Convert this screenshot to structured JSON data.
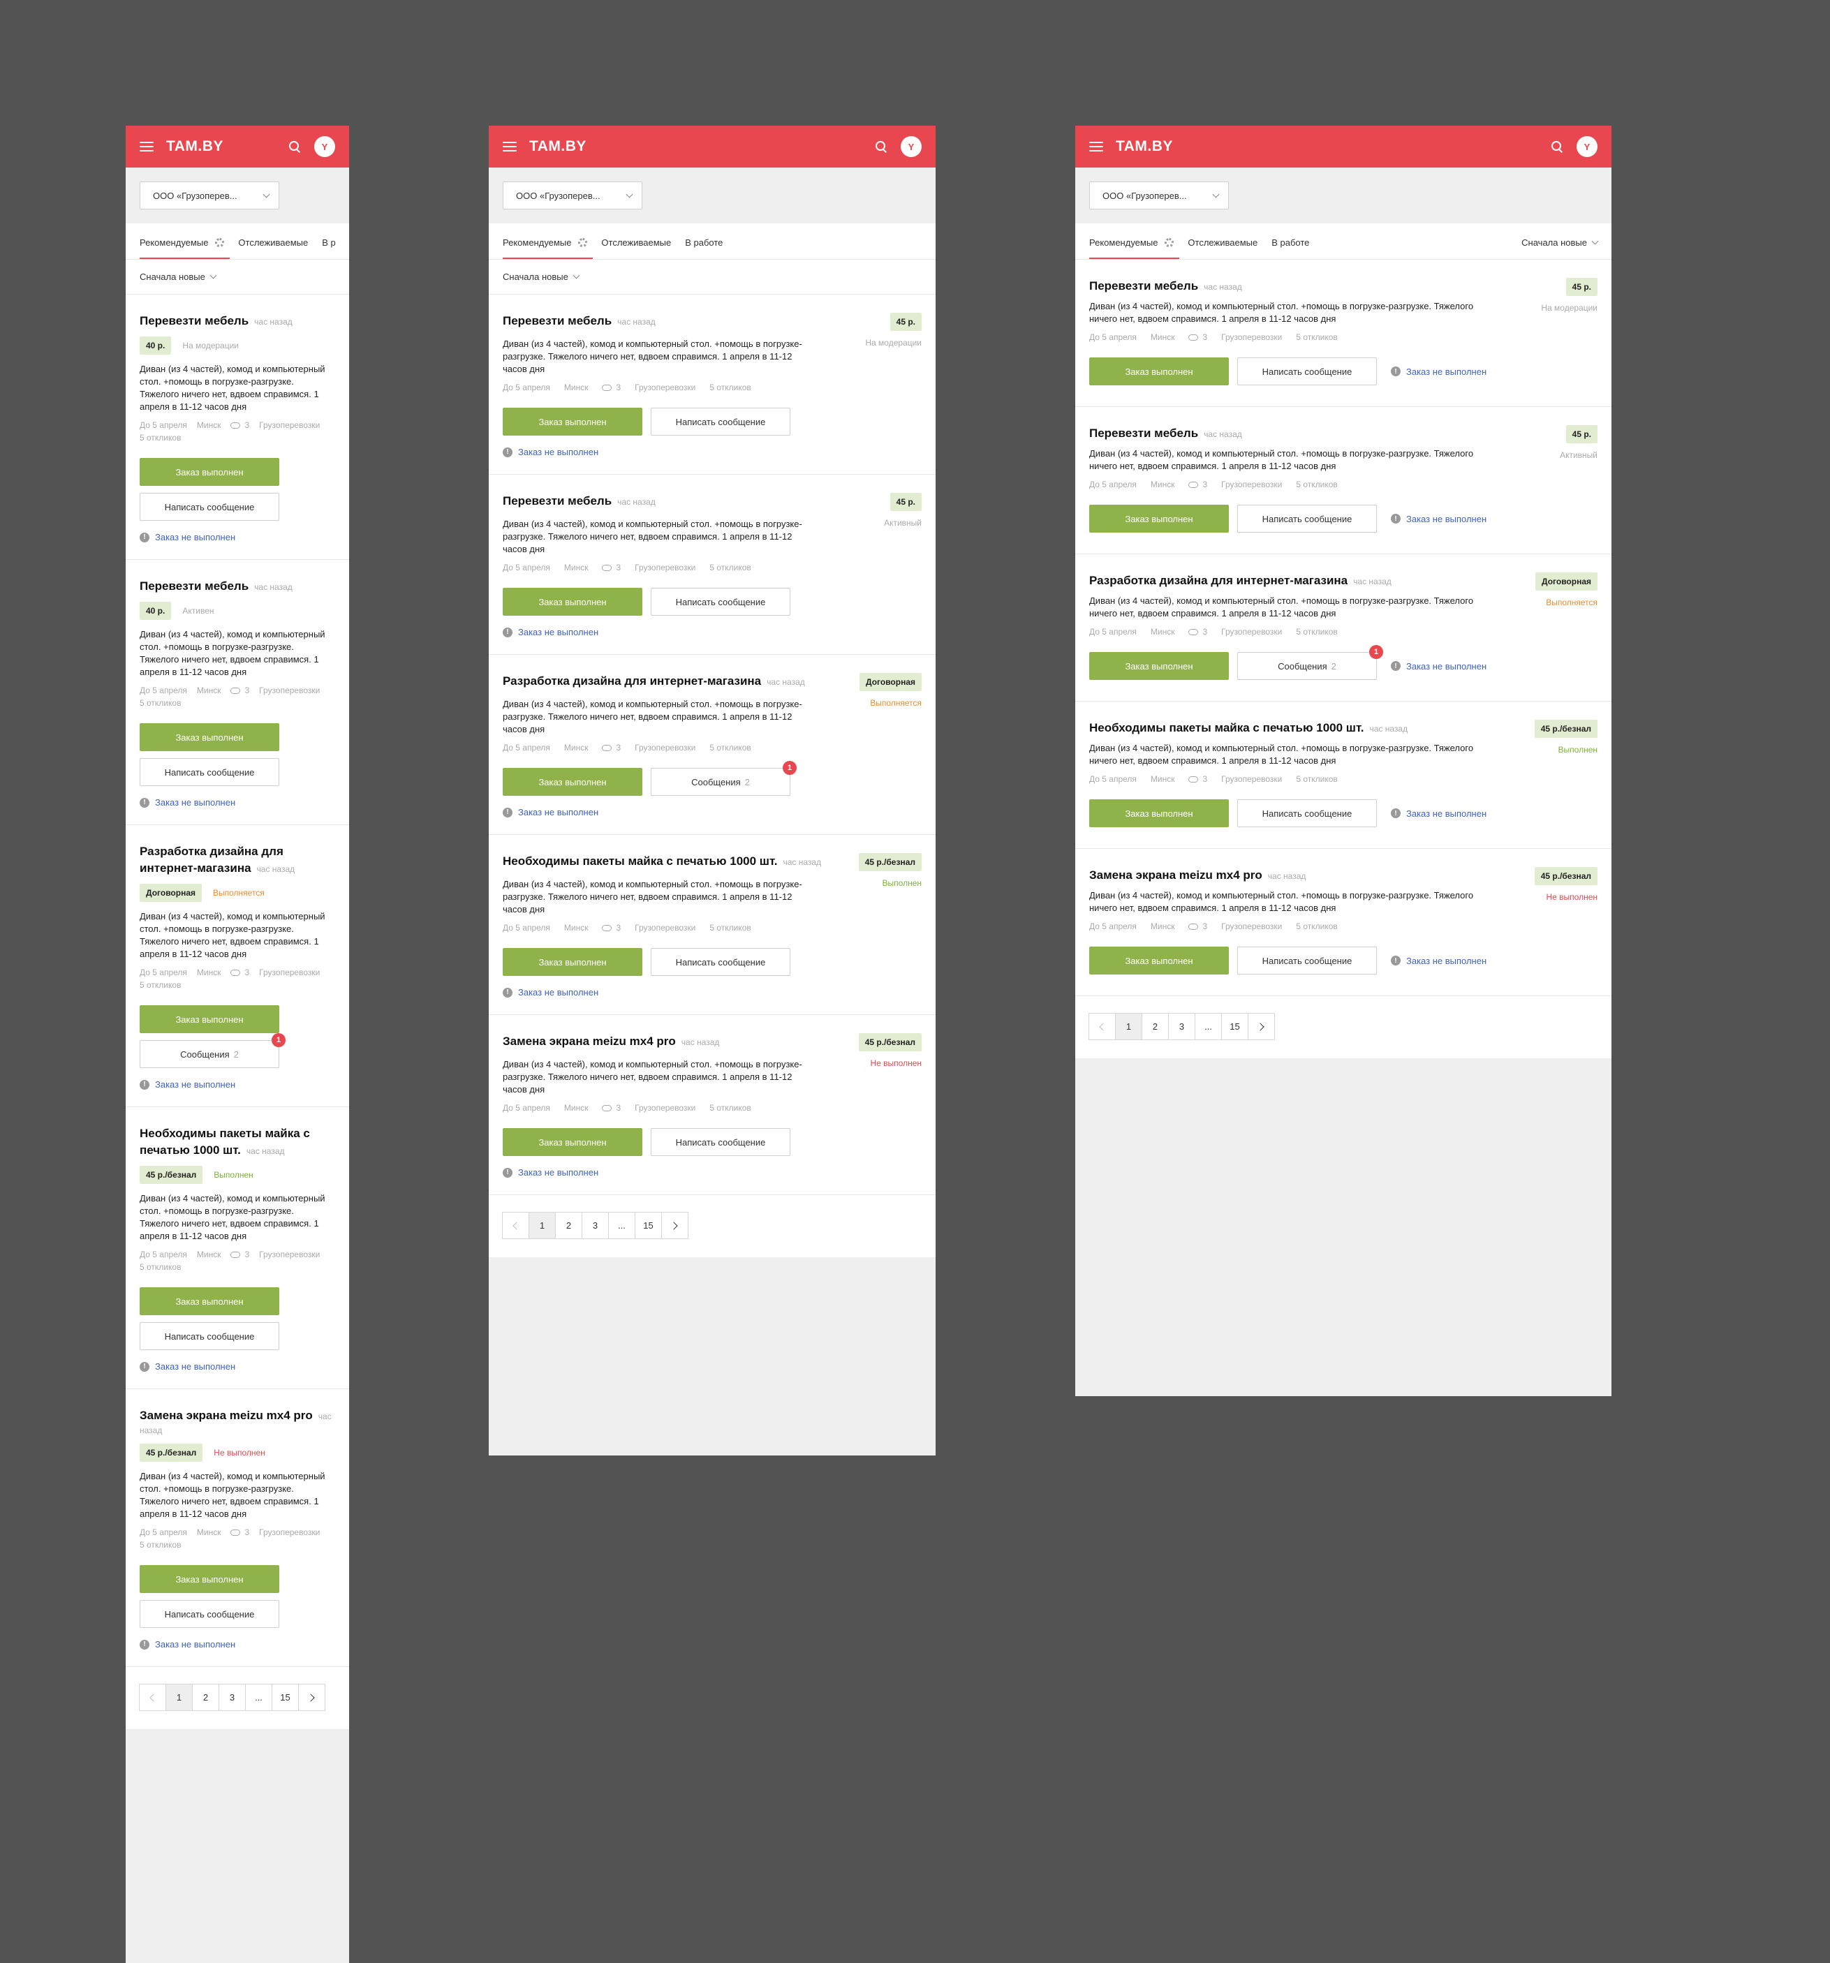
{
  "app": {
    "logo": "TAM.BY",
    "avatar_letter": "Y",
    "company": "ООО «Грузоперев...",
    "tabs": [
      "Рекомендуемые",
      "Отслеживаемые",
      "В работе"
    ],
    "tab_narrow_cut": "В р",
    "sort": "Сначала новые",
    "colors": {
      "brand": "#e9474f",
      "accent": "#8fb24a",
      "price_bg": "#e1ecd0",
      "link": "#3f62c6",
      "background": "#535353"
    },
    "icons": [
      "hamburger-menu-icon",
      "search-icon",
      "gear-icon",
      "chevron-down-icon",
      "comment-icon",
      "info-icon",
      "chevron-left-icon",
      "chevron-right-icon"
    ]
  },
  "cards": [
    {
      "title": "Перевезти мебель",
      "time": "час назад",
      "price": "40 р.",
      "price_wide": "45 р.",
      "status": "На модерации",
      "status_type": "moderation",
      "desc": "Диван (из 4 частей), комод и компьютерный стол. +помощь в погрузке-разгрузке. Тяжелого ничего нет, вдвоем справимся. 1 апреля в 11-12 часов дня",
      "date": "До 5 апреля",
      "city": "Минск",
      "comments": "3",
      "category": "Грузоперевозки",
      "responses": "5 откликов",
      "primary": "Заказ выполнен",
      "secondary": "Написать сообщение",
      "secondary_count": "",
      "badge": "",
      "fail_link": "Заказ не выполнен"
    },
    {
      "title": "Перевезти мебель",
      "time": "час назад",
      "price": "40 р.",
      "price_wide": "45 р.",
      "status": "Активный",
      "status_type": "active",
      "status_narrow": "Активен",
      "desc": "Диван (из 4 частей), комод и компьютерный стол. +помощь в погрузке-разгрузке. Тяжелого ничего нет, вдвоем справимся. 1 апреля в 11-12 часов дня",
      "date": "До 5 апреля",
      "city": "Минск",
      "comments": "3",
      "category": "Грузоперевозки",
      "responses": "5 откликов",
      "primary": "Заказ выполнен",
      "secondary": "Написать сообщение",
      "secondary_count": "",
      "badge": "",
      "fail_link": "Заказ не выполнен"
    },
    {
      "title": "Разработка дизайна для интернет-магазина",
      "time": "час назад",
      "price": "Договорная",
      "price_wide": "Договорная",
      "status": "Выполняется",
      "status_type": "progress",
      "desc": "Диван (из 4 частей), комод и компьютерный стол. +помощь в погрузке-разгрузке. Тяжелого ничего нет, вдвоем справимся. 1 апреля в 11-12 часов дня",
      "date": "До 5 апреля",
      "city": "Минск",
      "comments": "3",
      "category": "Грузоперевозки",
      "responses": "5 откликов",
      "primary": "Заказ выполнен",
      "secondary": "Сообщения",
      "secondary_count": "2",
      "badge": "1",
      "fail_link": "Заказ не выполнен"
    },
    {
      "title": "Необходимы пакеты майка с печатью 1000 шт.",
      "time": "час назад",
      "price": "45 р./безнал",
      "price_wide": "45 р./безнал",
      "status": "Выполнен",
      "status_type": "done",
      "desc": "Диван (из 4 частей), комод и компьютерный стол. +помощь в погрузке-разгрузке. Тяжелого ничего нет, вдвоем справимся. 1 апреля в 11-12 часов дня",
      "date": "До 5 апреля",
      "city": "Минск",
      "comments": "3",
      "category": "Грузоперевозки",
      "responses": "5 откликов",
      "primary": "Заказ выполнен",
      "secondary": "Написать сообщение",
      "secondary_count": "",
      "badge": "",
      "fail_link": "Заказ не выполнен"
    },
    {
      "title": "Замена экрана meizu mx4 pro",
      "time": "час назад",
      "price": "45 р./безнал",
      "price_wide": "45 р./безнал",
      "status": "Не выполнен",
      "status_type": "failed",
      "desc": "Диван (из 4 частей), комод и компьютерный стол. +помощь в погрузке-разгрузке. Тяжелого ничего нет, вдвоем справимся. 1 апреля в 11-12 часов дня",
      "date": "До 5 апреля",
      "city": "Минск",
      "comments": "3",
      "category": "Грузоперевозки",
      "responses": "5 откликов",
      "primary": "Заказ выполнен",
      "secondary": "Написать сообщение",
      "secondary_count": "",
      "badge": "",
      "fail_link": "Заказ не выполнен"
    }
  ],
  "cards_mid_prices": [
    "45 р.",
    "45 р.",
    "Договорная",
    "45 р./безнал",
    "45 р./безнал"
  ],
  "pagination": [
    "1",
    "2",
    "3",
    "...",
    "15"
  ],
  "pagination_current": "1"
}
